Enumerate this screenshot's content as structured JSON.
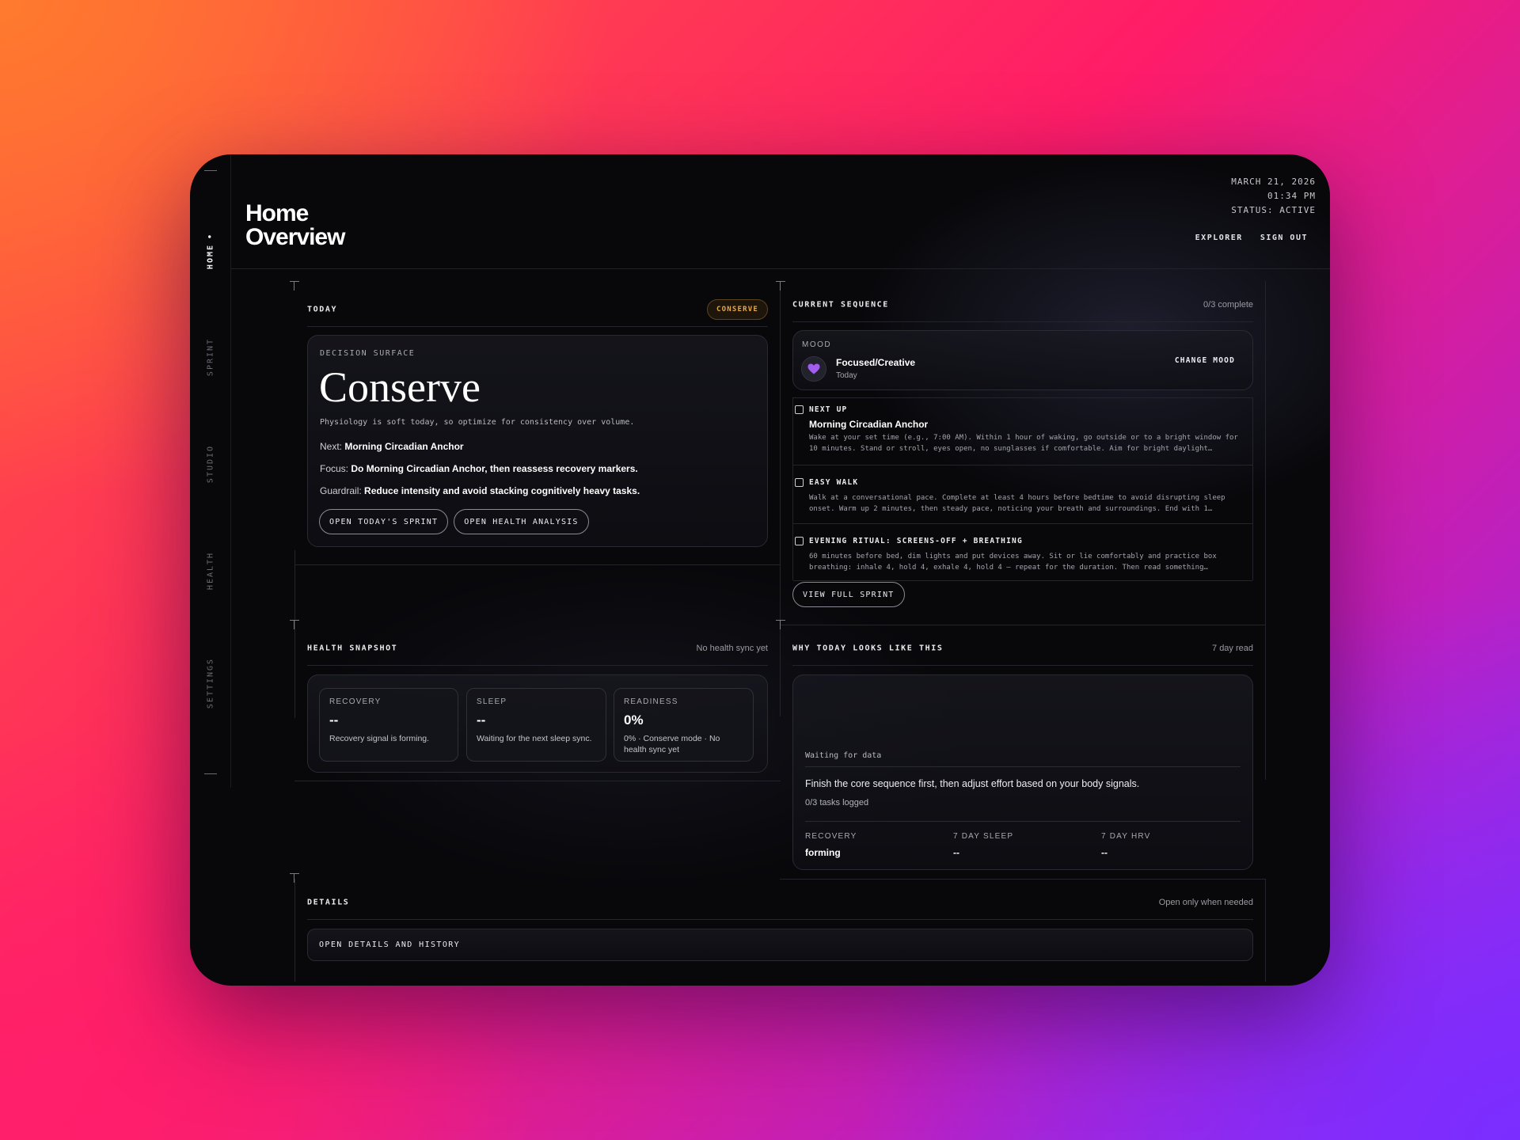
{
  "nav": {
    "items": [
      {
        "label": "HOME",
        "active": true
      },
      {
        "label": "SPRINT",
        "active": false
      },
      {
        "label": "STUDIO",
        "active": false
      },
      {
        "label": "HEALTH",
        "active": false
      },
      {
        "label": "SETTINGS",
        "active": false
      }
    ]
  },
  "header": {
    "title_line1": "Home",
    "title_line2": "Overview",
    "date": "MARCH 21, 2026",
    "time": "01:34 PM",
    "status": "STATUS: ACTIVE",
    "nav_explorer": "EXPLORER",
    "nav_sign_out": "SIGN OUT"
  },
  "today": {
    "title": "TODAY",
    "badge": "CONSERVE",
    "decision_label": "DECISION SURFACE",
    "decision": "Conserve",
    "summary": "Physiology is soft today, so optimize for consistency over volume.",
    "next_label": "Next:",
    "next_value": "Morning Circadian Anchor",
    "focus_label": "Focus:",
    "focus_value": "Do Morning Circadian Anchor, then reassess recovery markers.",
    "guardrail_label": "Guardrail:",
    "guardrail_value": "Reduce intensity and avoid stacking cognitively heavy tasks.",
    "btn_sprint": "OPEN TODAY'S SPRINT",
    "btn_health": "OPEN HEALTH ANALYSIS"
  },
  "sequence": {
    "title": "CURRENT SEQUENCE",
    "progress": "0/3 complete",
    "mood_label": "MOOD",
    "mood_icon": "purple-heart-emoji",
    "mood_value": "Focused/Creative",
    "mood_when": "Today",
    "change_mood": "CHANGE MOOD",
    "items": [
      {
        "label": "NEXT UP",
        "title": "Morning Circadian Anchor",
        "desc": "Wake at your set time (e.g., 7:00 AM). Within 1 hour of waking, go outside or to a bright window for 10 minutes. Stand or stroll, eyes open, no sunglasses if comfortable. Aim for bright daylight…",
        "checked": false
      },
      {
        "label": "EASY WALK",
        "title": "",
        "desc": "Walk at a conversational pace. Complete at least 4 hours before bedtime to avoid disrupting sleep onset. Warm up 2 minutes, then steady pace, noticing your breath and surroundings. End with 1…",
        "checked": false
      },
      {
        "label": "EVENING RITUAL: SCREENS-OFF + BREATHING",
        "title": "",
        "desc": "60 minutes before bed, dim lights and put devices away. Sit or lie comfortably and practice box breathing: inhale 4, hold 4, exhale 4, hold 4 — repeat for the duration. Then read something…",
        "checked": false
      }
    ],
    "view_full": "VIEW FULL SPRINT"
  },
  "health": {
    "title": "HEALTH SNAPSHOT",
    "sub": "No health sync yet",
    "metrics": [
      {
        "label": "RECOVERY",
        "value": "--",
        "desc": "Recovery signal is forming."
      },
      {
        "label": "SLEEP",
        "value": "--",
        "desc": "Waiting for the next sleep sync."
      },
      {
        "label": "READINESS",
        "value": "0%",
        "desc": "0% · Conserve mode · No health sync yet"
      }
    ]
  },
  "why": {
    "title": "WHY TODAY LOOKS LIKE THIS",
    "sub": "7 day read",
    "waiting": "Waiting for data",
    "advice": "Finish the core sequence first, then adjust effort based on your body signals.",
    "tasks": "0/3 tasks logged",
    "stats": [
      {
        "label": "RECOVERY",
        "value": "forming"
      },
      {
        "label": "7 DAY SLEEP",
        "value": "--"
      },
      {
        "label": "7 DAY HRV",
        "value": "--"
      }
    ]
  },
  "details": {
    "title": "DETAILS",
    "sub": "Open only when needed",
    "button": "OPEN DETAILS AND HISTORY"
  }
}
